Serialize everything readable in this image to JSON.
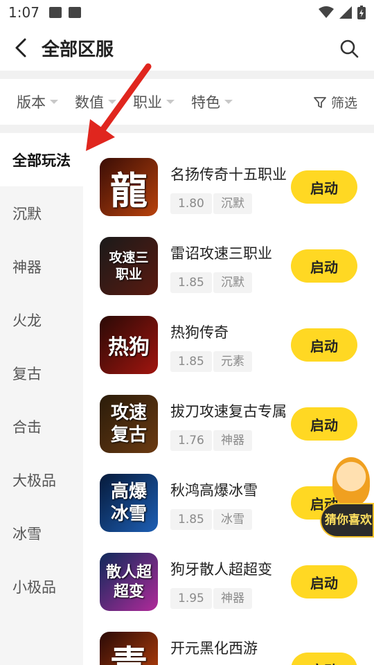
{
  "status_bar": {
    "time": "1:07"
  },
  "header": {
    "title": "全部区服"
  },
  "filters": {
    "items": [
      {
        "label": "版本"
      },
      {
        "label": "数值"
      },
      {
        "label": "职业"
      },
      {
        "label": "特色"
      }
    ],
    "filter_label": "筛选"
  },
  "sidebar": {
    "items": [
      {
        "label": "全部玩法",
        "active": true
      },
      {
        "label": "沉默"
      },
      {
        "label": "神器"
      },
      {
        "label": "火龙"
      },
      {
        "label": "复古"
      },
      {
        "label": "合击"
      },
      {
        "label": "大极品"
      },
      {
        "label": "冰雪"
      },
      {
        "label": "小极品"
      }
    ]
  },
  "games": [
    {
      "name": "名扬传奇十五职业",
      "version": "1.80",
      "category": "沉默",
      "icon_text": "龍",
      "icon_colors": [
        "#3a0d06",
        "#b8420c"
      ]
    },
    {
      "name": "雷诏攻速三职业",
      "version": "1.85",
      "category": "沉默",
      "icon_text": "攻速三职业",
      "icon_colors": [
        "#1a1a1a",
        "#5a1a10"
      ]
    },
    {
      "name": "热狗传奇",
      "version": "1.85",
      "category": "元素",
      "icon_text": "热狗",
      "icon_colors": [
        "#2a0a06",
        "#a1150f"
      ]
    },
    {
      "name": "拔刀攻速复古专属",
      "version": "1.76",
      "category": "神器",
      "icon_text": "攻速复古",
      "icon_colors": [
        "#2a1c0a",
        "#6b3a12"
      ]
    },
    {
      "name": "秋鸿高爆冰雪",
      "version": "1.85",
      "category": "冰雪",
      "icon_text": "高爆冰雪",
      "icon_colors": [
        "#061a3a",
        "#1d5fb5"
      ]
    },
    {
      "name": "狗牙散人超超变",
      "version": "1.95",
      "category": "神器",
      "icon_text": "散人超超变",
      "icon_colors": [
        "#0e2a5a",
        "#b02a9a"
      ]
    },
    {
      "name": "开元黑化西游",
      "version": "",
      "category": "",
      "icon_text": "青",
      "icon_colors": [
        "#2a0a06",
        "#c2440c"
      ]
    }
  ],
  "launch_label": "启动",
  "guess_widget": {
    "label": "猜你喜欢"
  },
  "colors": {
    "accent": "#ffd823",
    "annotation_arrow": "#e0261e"
  }
}
